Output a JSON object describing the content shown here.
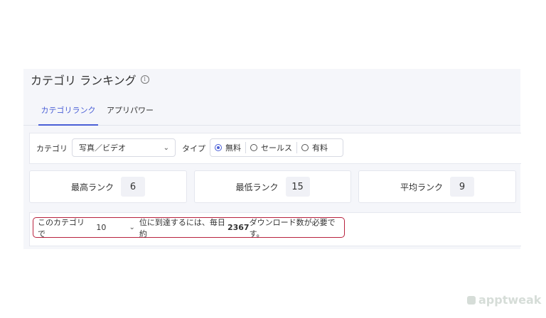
{
  "header": {
    "title": "カテゴリ ランキング",
    "info_icon": "i"
  },
  "tabs": [
    {
      "label": "カテゴリランク",
      "active": true
    },
    {
      "label": "アプリパワー",
      "active": false
    }
  ],
  "filters": {
    "category_label": "カテゴリ",
    "category_value": "写真／ビデオ",
    "type_label": "タイプ",
    "types": [
      {
        "label": "無料",
        "selected": true
      },
      {
        "label": "セールス",
        "selected": false
      },
      {
        "label": "有料",
        "selected": false
      }
    ]
  },
  "rank_cards": [
    {
      "label": "最高ランク",
      "value": "6"
    },
    {
      "label": "最低ランク",
      "value": "15"
    },
    {
      "label": "平均ランク",
      "value": "9"
    }
  ],
  "requirement": {
    "prefix": "このカテゴリで",
    "rank_value": "10",
    "middle": "位に到達するには、毎日約",
    "downloads": "2367",
    "suffix": "ダウンロード数が必要です。"
  },
  "watermark": {
    "text": "apptweak"
  },
  "colors": {
    "accent": "#4a5fd6",
    "highlight_border": "#b8223e",
    "panel_bg": "#f5f6fa"
  }
}
